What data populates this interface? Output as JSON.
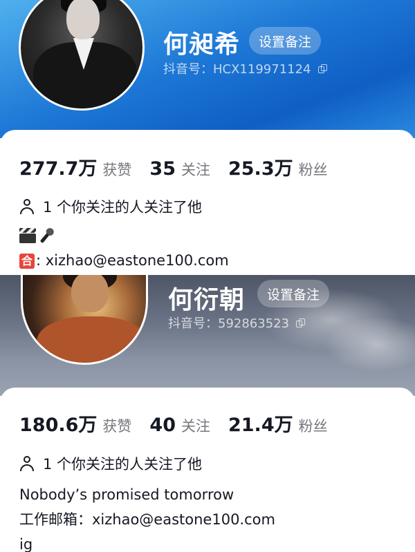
{
  "profiles": [
    {
      "name": "何昶希",
      "remark_button": "设置备注",
      "id_label": "抖音号：HCX119971124",
      "stats": [
        {
          "value": "277.7万",
          "label": "获赞"
        },
        {
          "value": "35",
          "label": "关注"
        },
        {
          "value": "25.3万",
          "label": "粉丝"
        }
      ],
      "mutual": "1 个你关注的人关注了他",
      "bio_icons": [
        "clapper-board-icon",
        "microphone-icon"
      ],
      "bio_badge": "合",
      "bio_email_line": ": xizhao@eastone100.com"
    },
    {
      "name": "何衍朝",
      "remark_button": "设置备注",
      "id_label": "抖音号：592863523",
      "stats": [
        {
          "value": "180.6万",
          "label": "获赞"
        },
        {
          "value": "40",
          "label": "关注"
        },
        {
          "value": "21.4万",
          "label": "粉丝"
        }
      ],
      "mutual": "1 个你关注的人关注了他",
      "bio_lines": [
        "Nobody’s promised tomorrow",
        "工作邮箱：xizhao@eastone100.com",
        "ig"
      ]
    }
  ],
  "colors": {
    "banner_blue": "#1e78d6",
    "banner_grey": "#6b7486",
    "text_primary": "#161823",
    "text_secondary": "#76777c",
    "badge_red": "#e8453c"
  }
}
